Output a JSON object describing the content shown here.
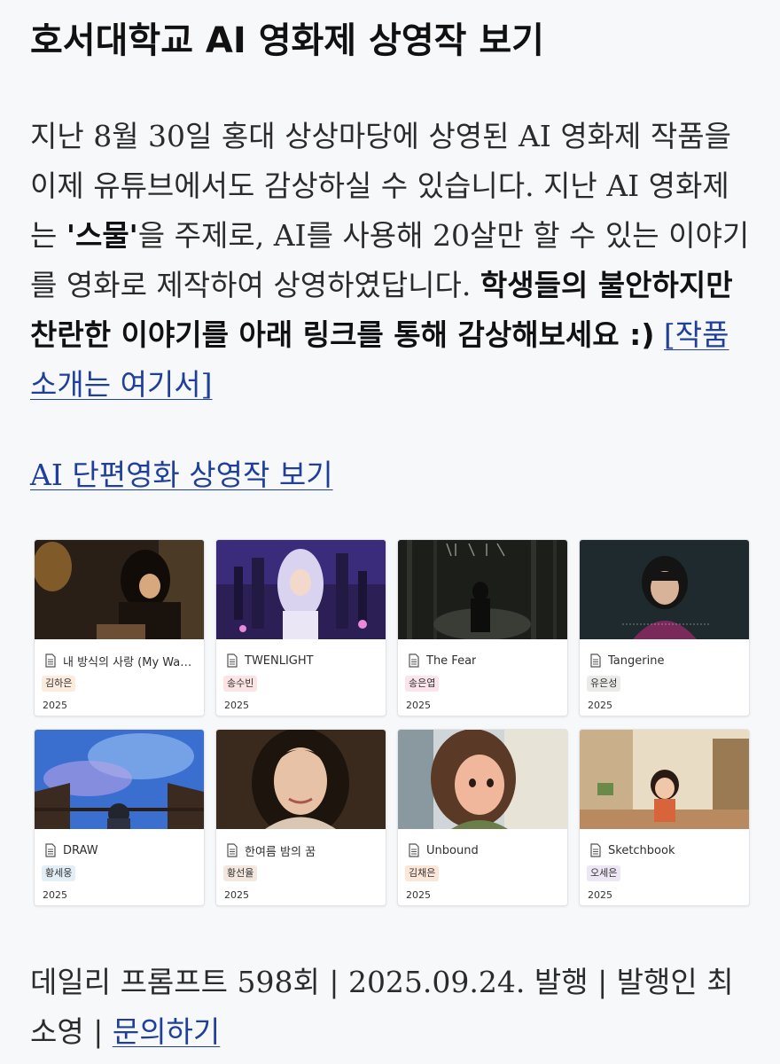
{
  "page": {
    "title": "호서대학교 AI 영화제 상영작 보기",
    "intro": {
      "text_before": "지난 8월 30일 홍대 상상마당에 상영된 AI 영화제 작품을 이제 유튜브에서도 감상하실 수 있습니다. 지난 AI 영화제는 ",
      "bold_theme": "'스물'",
      "text_middle": "을 주제로, AI를 사용해 20살만 할 수 있는 이야기를 영화로 제작하여 상영하였답니다. ",
      "bold_cta": "학생들의 불안하지만 찬란한 이야기를 아래 링크를 통해 감상해보세요 :)",
      "link_label": "[작품소개는 여기서]"
    },
    "section_link": "AI 단편영화 상영작 보기",
    "gallery": [
      {
        "title": "내 방식의 사랑 (My Way ...",
        "author": "김하은",
        "tag_color": "#fbecdd",
        "year": "2025",
        "thumb": "warm-room"
      },
      {
        "title": "TWENLIGHT",
        "author": "송수빈",
        "tag_color": "#fbe4e4",
        "year": "2025",
        "thumb": "castle-night"
      },
      {
        "title": "The Fear",
        "author": "송은엽",
        "tag_color": "#fbe4ec",
        "year": "2025",
        "thumb": "dark-forest"
      },
      {
        "title": "Tangerine",
        "author": "유은성",
        "tag_color": "#ebebea",
        "year": "2025",
        "thumb": "girl-dark"
      },
      {
        "title": "DRAW",
        "author": "황세웅",
        "tag_color": "#e3eef7",
        "year": "2025",
        "thumb": "sky-balcony"
      },
      {
        "title": "한여름 밤의 꿈",
        "author": "황선율",
        "tag_color": "#f4e7e0",
        "year": "2025",
        "thumb": "portrait-warm"
      },
      {
        "title": "Unbound",
        "author": "김채은",
        "tag_color": "#fbe6d8",
        "year": "2025",
        "thumb": "cartoon-window"
      },
      {
        "title": "Sketchbook",
        "author": "오세은",
        "tag_color": "#ece6f5",
        "year": "2025",
        "thumb": "cartoon-room"
      }
    ],
    "footer": {
      "issue": "데일리 프롬프트 598회 | 2025.09.24. 발행 | 발행인 최소영 | ",
      "contact_link": "문의하기"
    }
  }
}
